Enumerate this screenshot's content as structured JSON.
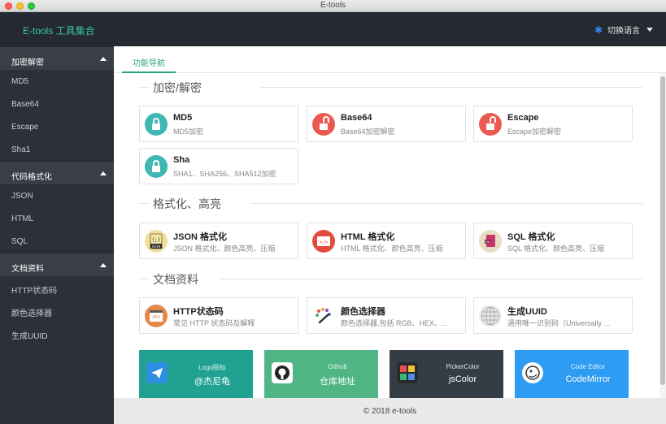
{
  "window": {
    "title": "E-tools"
  },
  "header": {
    "brand": "E-tools 工具集合",
    "lang_label": "切换语言"
  },
  "sidebar": {
    "groups": [
      {
        "label": "加密解密",
        "items": [
          "MD5",
          "Base64",
          "Escape",
          "Sha1"
        ]
      },
      {
        "label": "代码格式化",
        "items": [
          "JSON",
          "HTML",
          "SQL"
        ]
      },
      {
        "label": "文档资料",
        "items": [
          "HTTP状态码",
          "颜色选择器",
          "生成UUID"
        ]
      }
    ]
  },
  "main": {
    "tab": "功能导航",
    "sections": [
      {
        "title": "加密/解密",
        "cards": [
          {
            "title": "MD5",
            "desc": "MD5加密",
            "icon": "lock-icon"
          },
          {
            "title": "Base64",
            "desc": "Base64加密解密",
            "icon": "unlock-icon"
          },
          {
            "title": "Escape",
            "desc": "Escape加密解密",
            "icon": "unlock-icon"
          },
          {
            "title": "Sha",
            "desc": "SHA1、SHA256、SHA512加密",
            "icon": "lock-icon"
          }
        ]
      },
      {
        "title": "格式化、高亮",
        "cards": [
          {
            "title": "JSON 格式化",
            "desc": "JSON 格式化、颜色高亮、压缩",
            "icon": "json-file-icon"
          },
          {
            "title": "HTML 格式化",
            "desc": "HTML 格式化、颜色高亮、压缩",
            "icon": "html-code-icon"
          },
          {
            "title": "SQL 格式化",
            "desc": "SQL 格式化、颜色高亮、压缩",
            "icon": "sql-file-icon"
          }
        ]
      },
      {
        "title": "文档资料",
        "cards": [
          {
            "title": "HTTP状态码",
            "desc": "常见 HTTP 状态码及解释",
            "icon": "http-404-icon"
          },
          {
            "title": "颜色选择器",
            "desc": "颜色选择器,包括 RGB、HEX、...",
            "icon": "color-palette-icon"
          },
          {
            "title": "生成UUID",
            "desc": "通用唯一识别码（Universally ...",
            "icon": "uuid-sphere-icon"
          }
        ]
      }
    ],
    "links": [
      {
        "small": "Logo图标",
        "big": "@杰尼龟",
        "color": "#20a192",
        "icon": "telegram-icon"
      },
      {
        "small": "Github",
        "big": "仓库地址",
        "color": "#4fb584",
        "icon": "github-icon"
      },
      {
        "small": "PickerColor",
        "big": "jsColor",
        "color": "#343d46",
        "icon": "color-grid-icon"
      },
      {
        "small": "Code Editor",
        "big": "CodeMirror",
        "color": "#2d9cf2",
        "icon": "codemirror-icon"
      }
    ],
    "footer": "© 2018 e-tools"
  },
  "colors": {
    "accent": "#2aa57e",
    "sidebar_bg": "#2d3038",
    "header_bg": "#252a32",
    "brand": "#38c5a8"
  }
}
